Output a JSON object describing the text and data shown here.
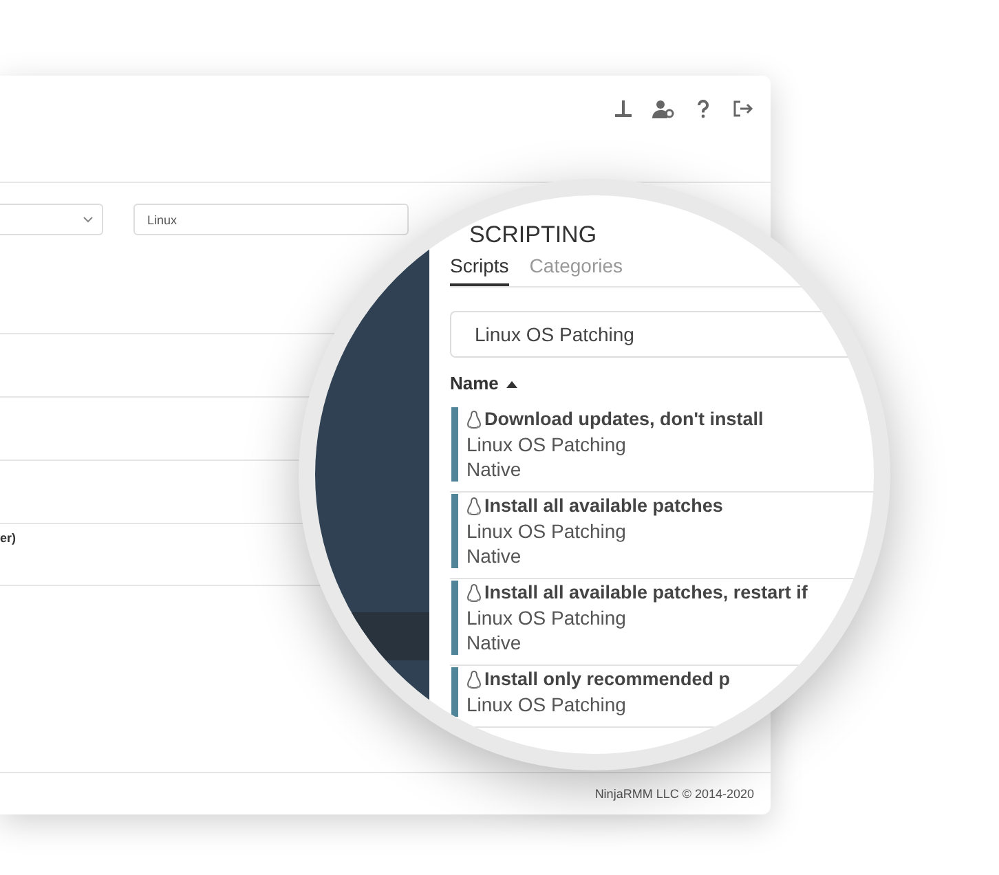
{
  "os_filter": {
    "value": "Linux"
  },
  "partial_row_text": "er)",
  "footer": "NinjaRMM LLC © 2014-2020",
  "lens": {
    "title": "SCRIPTING",
    "tabs": [
      {
        "label": "Scripts",
        "selected": true
      },
      {
        "label": "Categories",
        "selected": false
      }
    ],
    "search": {
      "value": "Linux OS Patching"
    },
    "sort_column": {
      "label": "Name",
      "ascending": true
    },
    "scripts": [
      {
        "name": "Download updates, don't install",
        "category": "Linux OS Patching",
        "type": "Native"
      },
      {
        "name": "Install all available patches",
        "category": "Linux OS Patching",
        "type": "Native"
      },
      {
        "name": "Install all available patches, restart if",
        "category": "Linux OS Patching",
        "type": "Native"
      },
      {
        "name": "Install only recommended p",
        "category": "Linux OS Patching"
      }
    ]
  }
}
